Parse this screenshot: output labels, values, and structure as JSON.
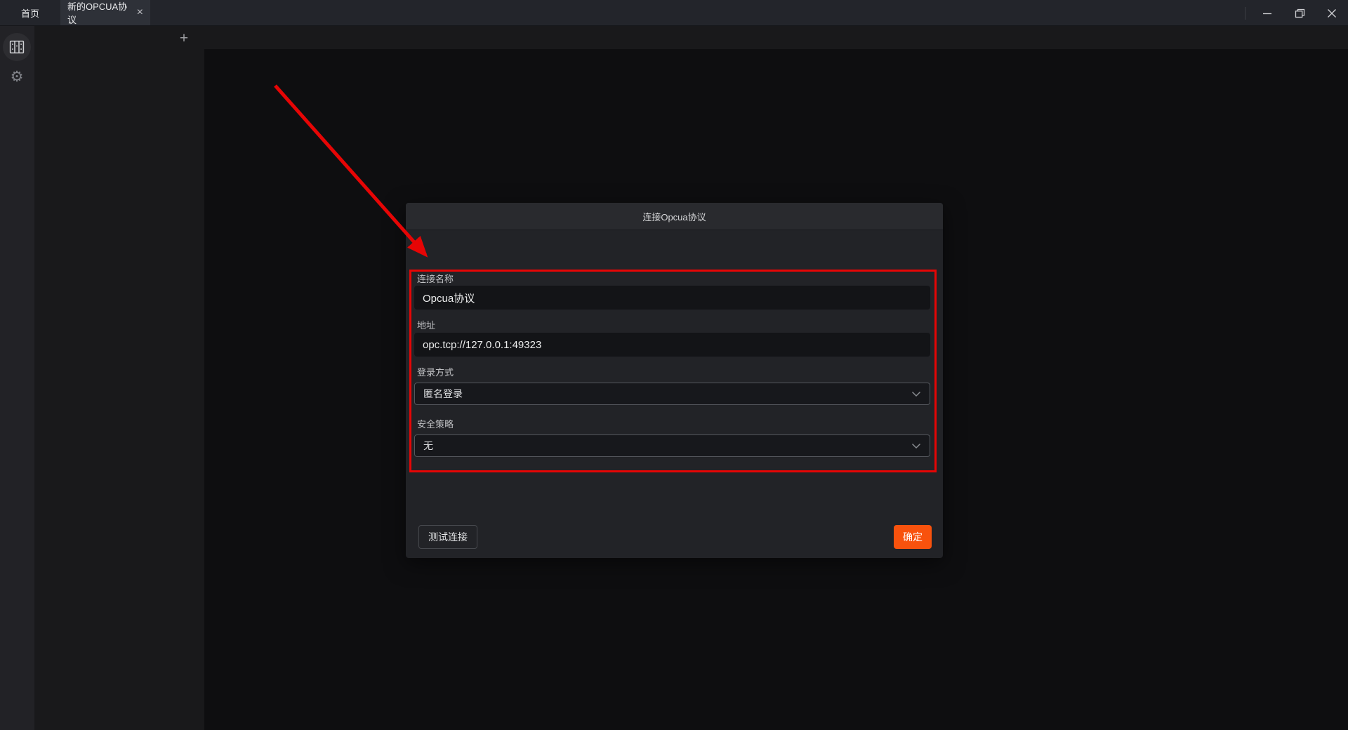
{
  "titlebar": {
    "tabs": [
      {
        "label": "首页"
      },
      {
        "label": "新的OPCUA协议"
      }
    ],
    "tab_close_glyph": "×"
  },
  "sidebar": {
    "items": [
      {
        "icon": "devices-icon",
        "active": true
      },
      {
        "icon": "settings-icon",
        "active": false
      }
    ],
    "settings_glyph": "⚙"
  },
  "panel": {
    "add_glyph": "+"
  },
  "dialog": {
    "title": "连接Opcua协议",
    "fields": [
      {
        "label": "连接名称",
        "type": "text",
        "value": "Opcua协议"
      },
      {
        "label": "地址",
        "type": "text",
        "value": "opc.tcp://127.0.0.1:49323"
      },
      {
        "label": "登录方式",
        "type": "select",
        "value": "匿名登录"
      },
      {
        "label": "安全策略",
        "type": "select",
        "value": "无"
      }
    ],
    "buttons": {
      "test": "测试连接",
      "ok": "确定"
    }
  },
  "colors": {
    "accent_orange": "#f8520d",
    "annotation_red": "#e60505"
  }
}
